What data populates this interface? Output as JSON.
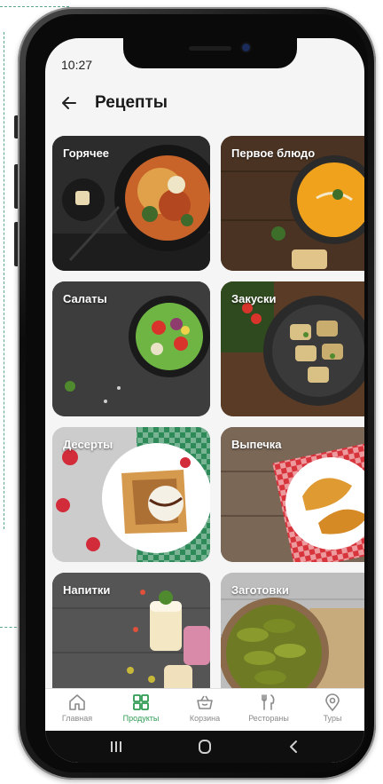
{
  "status": {
    "time": "10:27"
  },
  "header": {
    "title": "Рецепты"
  },
  "categories": [
    {
      "label": "Горячее"
    },
    {
      "label": "Первое блюдо"
    },
    {
      "label": "Салаты"
    },
    {
      "label": "Закуски"
    },
    {
      "label": "Десерты"
    },
    {
      "label": "Выпечка"
    },
    {
      "label": "Напитки"
    },
    {
      "label": "Заготовки"
    }
  ],
  "tabs": [
    {
      "label": "Главная",
      "icon": "home-icon"
    },
    {
      "label": "Продукты",
      "icon": "grid-icon",
      "active": true
    },
    {
      "label": "Корзина",
      "icon": "basket-icon"
    },
    {
      "label": "Рестораны",
      "icon": "cutlery-icon"
    },
    {
      "label": "Туры",
      "icon": "location-pin-icon"
    }
  ],
  "nav": {
    "icons": [
      "recent-apps-icon",
      "home-circle-icon",
      "back-chevron-icon"
    ]
  },
  "colors": {
    "accent": "#2e9b52",
    "tab_inactive": "#8a8a8a",
    "background": "#f5f5f5"
  }
}
